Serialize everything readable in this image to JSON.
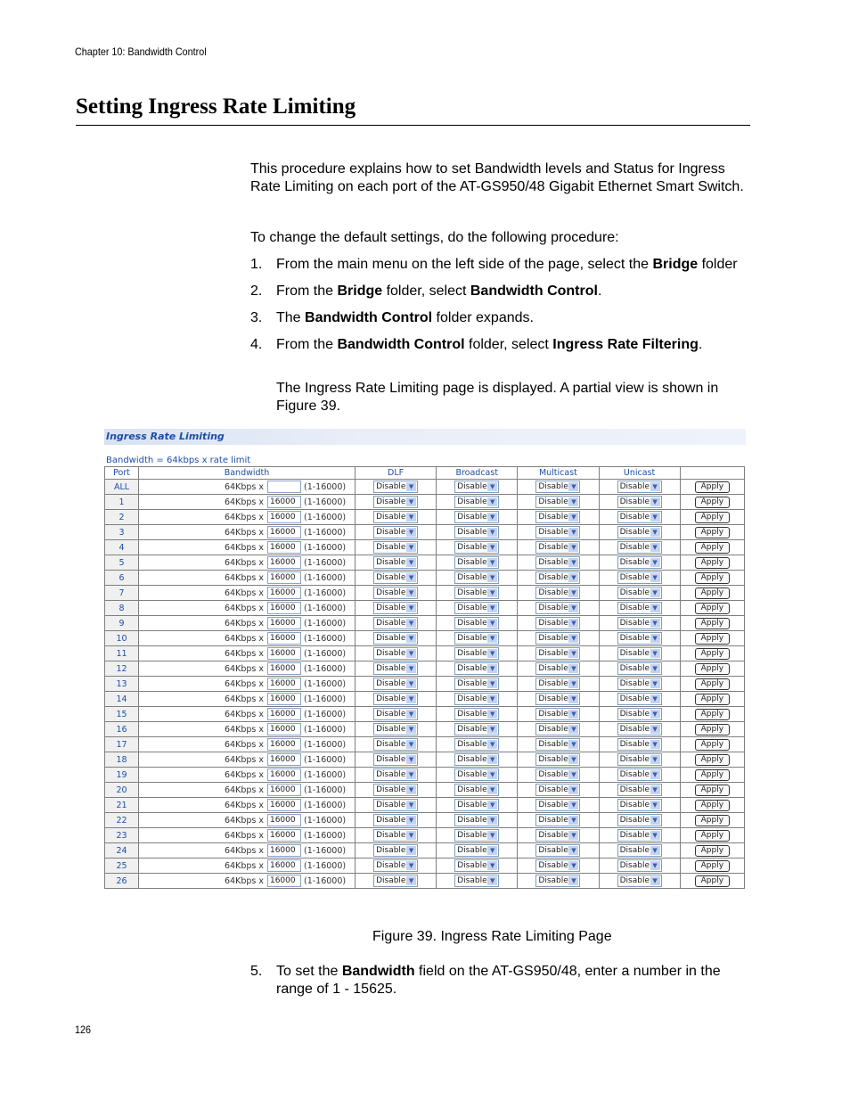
{
  "running_head": "Chapter 10: Bandwidth Control",
  "title": "Setting Ingress Rate Limiting",
  "intro": "This procedure explains how to set Bandwidth levels and Status for Ingress Rate Limiting on each port of the AT-GS950/48 Gigabit Ethernet Smart Switch.",
  "lead_in": "To change the default settings, do the following procedure:",
  "steps": [
    {
      "num": "1.",
      "parts": [
        {
          "t": "From the main menu on the left side of the page, select the "
        },
        {
          "t": "Bridge",
          "b": true
        },
        {
          "t": " folder"
        }
      ]
    },
    {
      "num": "2.",
      "parts": [
        {
          "t": "From the "
        },
        {
          "t": "Bridge",
          "b": true
        },
        {
          "t": " folder, select "
        },
        {
          "t": "Bandwidth Control",
          "b": true
        },
        {
          "t": "."
        }
      ]
    },
    {
      "num": "3.",
      "parts": [
        {
          "t": "The "
        },
        {
          "t": "Bandwidth Control",
          "b": true
        },
        {
          "t": " folder expands."
        }
      ]
    },
    {
      "num": "4.",
      "parts": [
        {
          "t": "From the "
        },
        {
          "t": "Bandwidth Control",
          "b": true
        },
        {
          "t": " folder, select "
        },
        {
          "t": "Ingress Rate Filtering",
          "b": true
        },
        {
          "t": "."
        }
      ]
    }
  ],
  "after_step4": "The Ingress Rate Limiting page is displayed. A partial view is shown in Figure 39.",
  "figure": {
    "banner": "Ingress Rate Limiting",
    "subtitle": "Bandwidth = 64kbps x rate limit",
    "headers": [
      "Port",
      "Bandwidth",
      "DLF",
      "Broadcast",
      "Multicast",
      "Unicast",
      ""
    ],
    "bw_prefix": "64Kbps x",
    "bw_range": "(1-16000)",
    "select_value": "Disable",
    "apply_label": "Apply",
    "rows": [
      {
        "port": "ALL",
        "value": ""
      },
      {
        "port": "1",
        "value": "16000"
      },
      {
        "port": "2",
        "value": "16000"
      },
      {
        "port": "3",
        "value": "16000"
      },
      {
        "port": "4",
        "value": "16000"
      },
      {
        "port": "5",
        "value": "16000"
      },
      {
        "port": "6",
        "value": "16000"
      },
      {
        "port": "7",
        "value": "16000"
      },
      {
        "port": "8",
        "value": "16000"
      },
      {
        "port": "9",
        "value": "16000"
      },
      {
        "port": "10",
        "value": "16000"
      },
      {
        "port": "11",
        "value": "16000"
      },
      {
        "port": "12",
        "value": "16000"
      },
      {
        "port": "13",
        "value": "16000"
      },
      {
        "port": "14",
        "value": "16000"
      },
      {
        "port": "15",
        "value": "16000"
      },
      {
        "port": "16",
        "value": "16000"
      },
      {
        "port": "17",
        "value": "16000"
      },
      {
        "port": "18",
        "value": "16000"
      },
      {
        "port": "19",
        "value": "16000"
      },
      {
        "port": "20",
        "value": "16000"
      },
      {
        "port": "21",
        "value": "16000"
      },
      {
        "port": "22",
        "value": "16000"
      },
      {
        "port": "23",
        "value": "16000"
      },
      {
        "port": "24",
        "value": "16000"
      },
      {
        "port": "25",
        "value": "16000"
      },
      {
        "port": "26",
        "value": "16000"
      }
    ]
  },
  "caption": "Figure 39. Ingress Rate Limiting Page",
  "step5": {
    "num": "5.",
    "parts": [
      {
        "t": "To set the "
      },
      {
        "t": "Bandwidth",
        "b": true
      },
      {
        "t": " field on the AT-GS950/48, enter a number in the range of 1 - 15625."
      }
    ]
  },
  "page_number": "126"
}
